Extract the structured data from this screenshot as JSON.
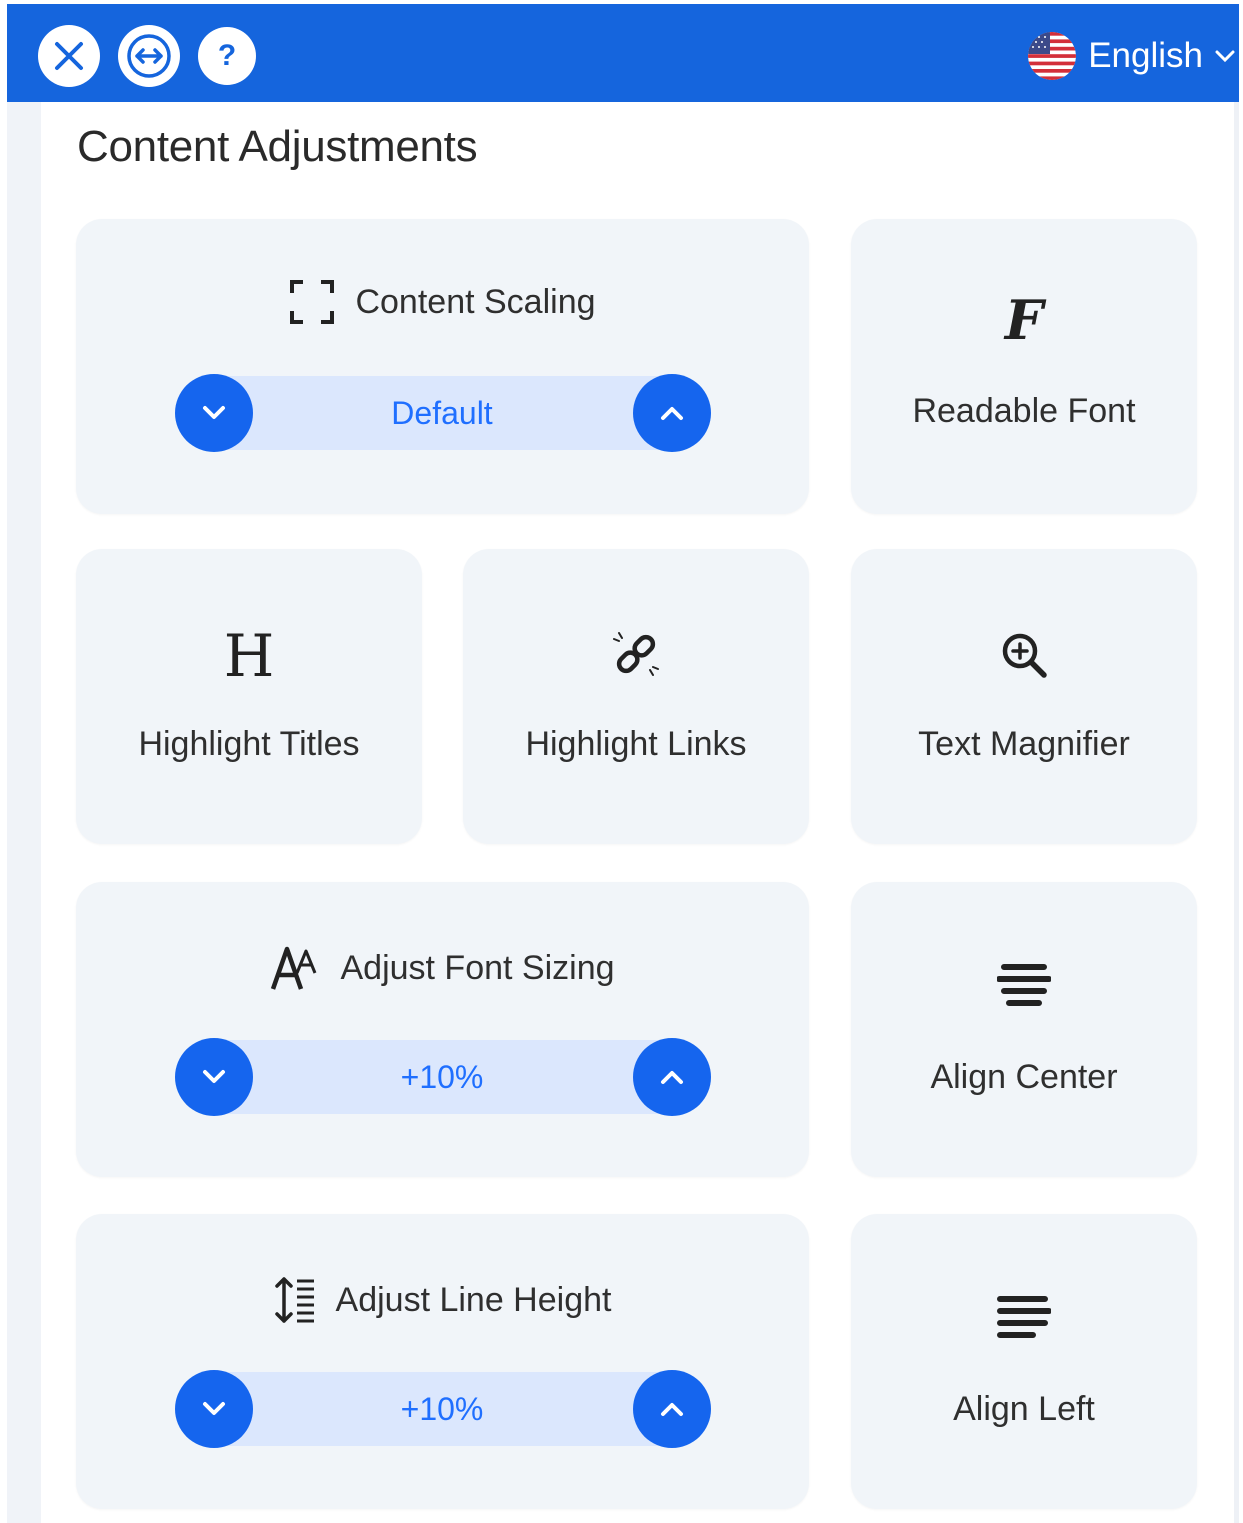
{
  "header": {
    "close_icon": "close-icon",
    "resize_icon": "horizontal-resize-icon",
    "help_icon": "help-icon",
    "help_glyph": "?",
    "language": "English"
  },
  "section": {
    "title": "Content Adjustments"
  },
  "content_scaling": {
    "label": "Content Scaling",
    "value": "Default",
    "icon": "content-scaling-icon"
  },
  "readable_font": {
    "label": "Readable Font",
    "icon": "readable-font-icon",
    "glyph": "F"
  },
  "highlight_titles": {
    "label": "Highlight Titles",
    "icon": "heading-icon",
    "glyph": "H"
  },
  "highlight_links": {
    "label": "Highlight Links",
    "icon": "link-icon"
  },
  "text_magnifier": {
    "label": "Text Magnifier",
    "icon": "magnifier-icon"
  },
  "font_sizing": {
    "label": "Adjust Font Sizing",
    "value": "+10%",
    "icon": "font-size-icon",
    "glyph": "A"
  },
  "align_center": {
    "label": "Align Center",
    "icon": "align-center-icon"
  },
  "line_height": {
    "label": "Adjust Line Height",
    "value": "+10%",
    "icon": "line-height-icon"
  },
  "align_left": {
    "label": "Align Left",
    "icon": "align-left-icon"
  },
  "colors": {
    "header_bg": "#1565dd",
    "accent": "#1565ee",
    "card_bg": "#f1f5f9",
    "stepper_track": "#dbe7fd",
    "stepper_text": "#1f6fff"
  }
}
